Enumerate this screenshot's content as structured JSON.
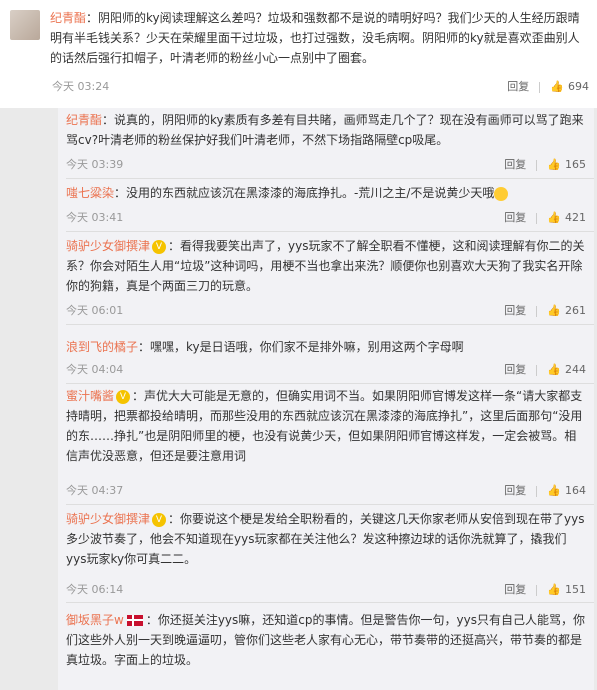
{
  "main_comment": {
    "author": "纪青酯",
    "text": "：阴阳师的ky阅读理解这么差吗？垃圾和强数都不是说的晴明好吗？我们少天的人生经历跟晴明有半毛钱关系？少天在荣耀里面干过垃圾，也打过强数，没毛病啊。阴阳师的ky就是喜欢歪曲别人的话然后强行扣帽子，叶清老师的粉丝小心一点别中了圈套。",
    "time": "今天 03:24",
    "reply_label": "回复",
    "likes": "694"
  },
  "replies": [
    {
      "author": "纪青酯",
      "text": "：说真的，阴阳师的ky素质有多差有目共睹，画师骂走几个了？现在没有画师可以骂了跑来骂cv?叶清老师的粉丝保护好我们叶清老师，不然下场指路隔壁cp吸尾。",
      "time": "今天 03:39",
      "reply_label": "回复",
      "likes": "165"
    },
    {
      "author": "嗤七粱染",
      "text": "：没用的东西就应该沉在黑漆漆的海底挣扎。-荒川之主/不是说黄少天哦",
      "time": "今天 03:41",
      "reply_label": "回复",
      "likes": "421"
    },
    {
      "author": "骑驴少女御撰津",
      "text": "：看得我要笑出声了，yys玩家不了解全职看不懂梗，这和阅读理解有你二的关系？你会对陌生人用“垃圾”这种词吗，用梗不当也拿出来洗？顺便你也别喜欢大天狗了我实名开除你的狗籍，真是个两面三刀的玩意。",
      "time": "今天 06:01",
      "reply_label": "回复",
      "likes": "261"
    },
    {
      "author": "浪到飞的橘子",
      "text": "：嘿嘿，ky是日语哦，你们家不是排外嘛，别用这两个字母啊",
      "time": "今天 04:04",
      "reply_label": "回复",
      "likes": "244"
    },
    {
      "author": "蜜汁嘴酱",
      "text": "：声优大大可能是无意的，但确实用词不当。如果阴阳师官博发这样一条“请大家都支持晴明，把票都投给晴明，而那些没用的东西就应该沉在黑漆漆的海底挣扎”，这里后面那句“没用的东……挣扎”也是阴阳师里的梗，也没有说黄少天，但如果阴阳师官博这样发，一定会被骂。相信声优没恶意，但还是要注意用词",
      "time": "今天 04:37",
      "reply_label": "回复",
      "likes": "164"
    },
    {
      "author": "骑驴少女御撰津",
      "text": "：你要说这个梗是发给全职粉看的，关键这几天你家老师从安倍到现在带了yys多少波节奏了，他会不知道现在yys玩家都在关注他么？发这种擦边球的话你洗就算了，撬我们yys玩家ky你可真二二。",
      "time": "今天 06:14",
      "reply_label": "回复",
      "likes": "151"
    },
    {
      "author": "御坂黑子w",
      "text": "：你还挺关注yys嘛，还知道cp的事情。但是警告你一句，yys只有自己人能骂，你们这些外人别一天到晚逼逼叨，管你们这些老人家有心无心，带节奏带的还挺高兴，带节奏的都是真垃圾。字面上的垃圾。"
    }
  ]
}
